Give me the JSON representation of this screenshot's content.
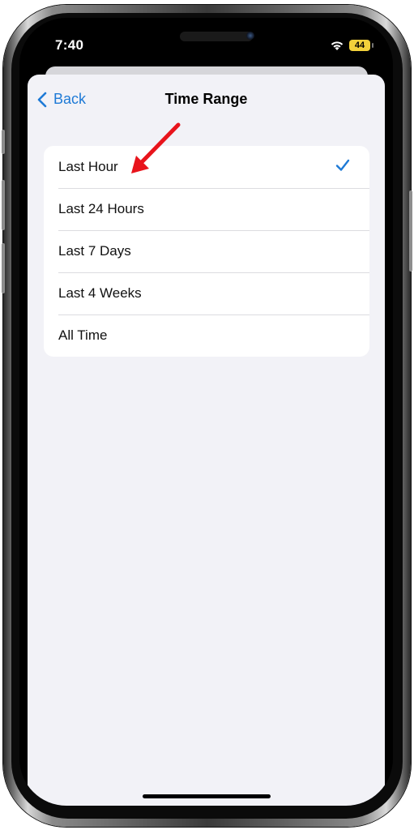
{
  "status_bar": {
    "time": "7:40",
    "battery_level": "44"
  },
  "nav": {
    "back_label": "Back",
    "title": "Time Range"
  },
  "options": [
    {
      "label": "Last Hour",
      "selected": true
    },
    {
      "label": "Last 24 Hours",
      "selected": false
    },
    {
      "label": "Last 7 Days",
      "selected": false
    },
    {
      "label": "Last 4 Weeks",
      "selected": false
    },
    {
      "label": "All Time",
      "selected": false
    }
  ],
  "colors": {
    "accent": "#1e7ad6",
    "background": "#f2f2f7",
    "annotation_arrow": "#e8141c",
    "battery": "#f2d13b"
  },
  "icons": [
    "chevron-left-icon",
    "checkmark-icon",
    "wifi-icon",
    "battery-icon",
    "annotation-arrow-icon"
  ]
}
